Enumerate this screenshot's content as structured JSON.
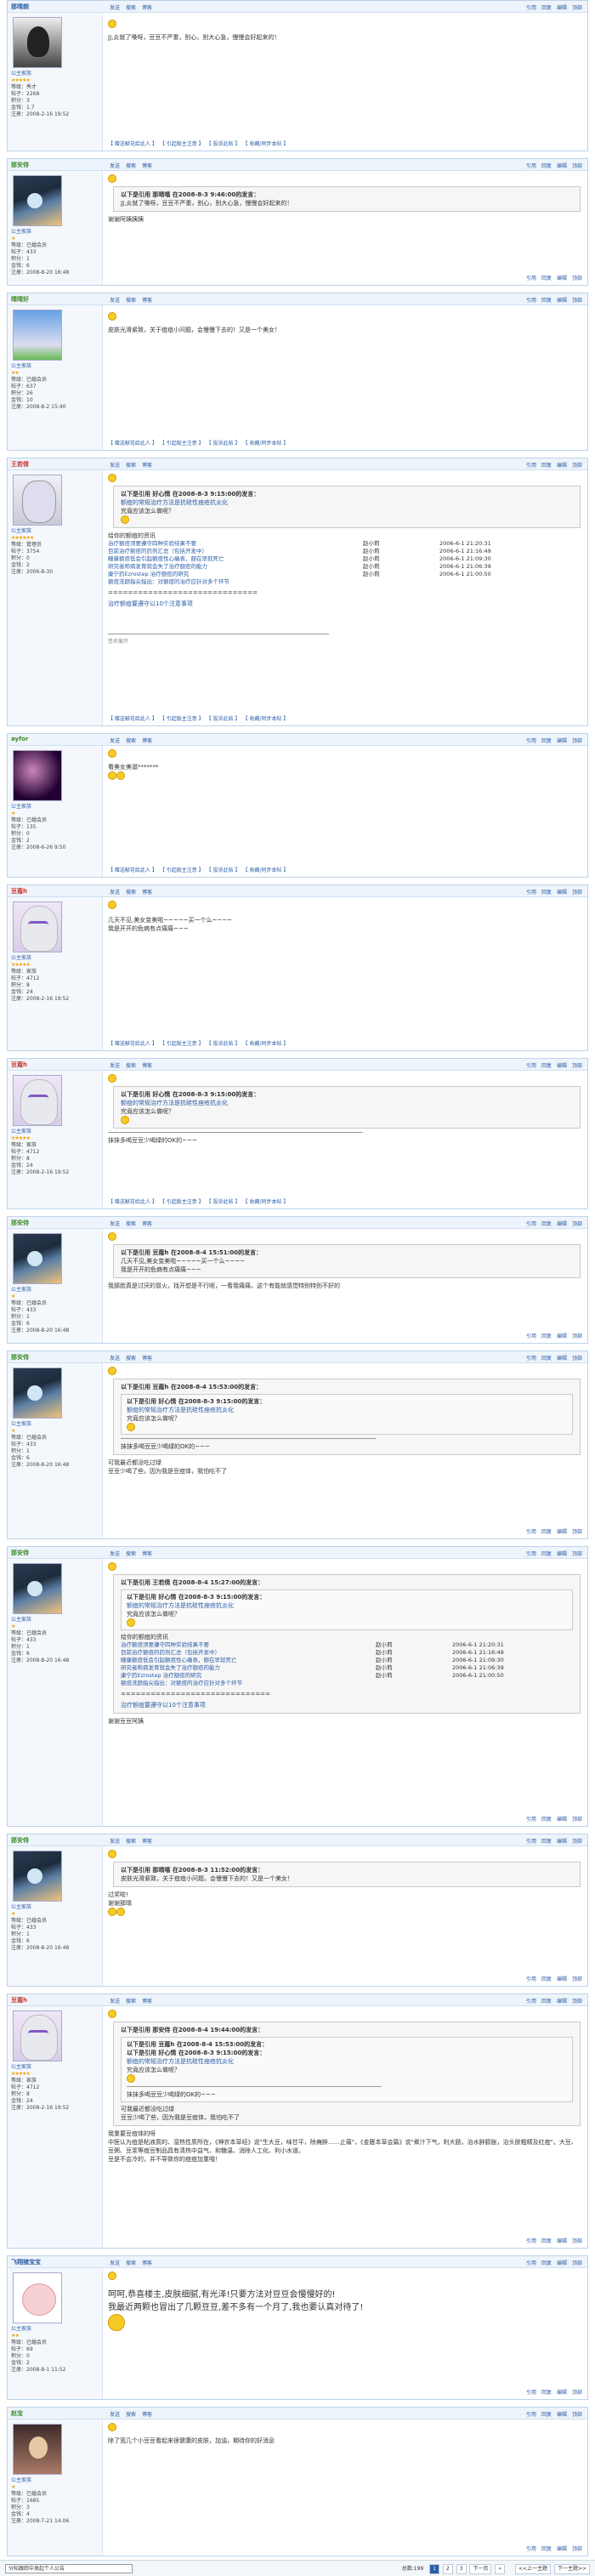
{
  "common": {
    "actions": [
      "发送",
      "搜索",
      "博客"
    ],
    "rightlinks": [
      "引用",
      "回复",
      "编辑",
      "顶部"
    ],
    "sig": [
      "【 赠送献花给此人 】",
      "【 引起版主注意 】",
      "【 投诉此帖 】",
      "【 收藏/同步本帖 】"
    ]
  },
  "posts": [
    {
      "user": "那晴朗",
      "group": "公主家族",
      "stars": "★★★★★",
      "info": [
        "等级：秀才",
        "帖子：2268",
        "积分：3",
        "金钱：1.7",
        "注册：2008-2-16 19:52"
      ],
      "body": "JJ,炎就了嗓呀，豆豆不严重，别心，别大心急，慢慢会好起来的！"
    },
    {
      "user": "那安侍",
      "group": "公主家族",
      "stars": "★",
      "info": [
        "等级：已婚会员",
        "帖子：433",
        "积分：1",
        "金钱：6",
        "注册：2008-8-20 16:48"
      ],
      "quote_head": "以下是引用 那晴嘻 在2008-8-3 9:46:00的发言：",
      "quote": "JJ,炎就了嗓呀，豆豆不严重，别心，别大心急，慢慢会好起来的！",
      "body": "谢谢阿姨姨姨"
    },
    {
      "user": "晴晴好",
      "group": "公主家族",
      "stars": "★★",
      "info": [
        "等级：已婚会员",
        "帖子：637",
        "积分：26",
        "金钱：10",
        "注册：2008-8-2 15:40"
      ],
      "body": "皮肤光滑紧致，关于痘痘小问题，会慢慢下去的！又是一个美女！"
    },
    {
      "user": "王若倩",
      "group": "公主家族",
      "stars": "★★★★★★",
      "info": [
        "等级：管理员",
        "帖子：3754",
        "积分：0",
        "金钱：2",
        "注册：2006-8-30"
      ],
      "quote_head": "以下是引用 好心情 在2008-8-3 9:15:00的发言：",
      "quote_lines": [
        "额痘的常规治疗方法是抗硅性痤疮抗炎化",
        "究竟应该怎么做呢？"
      ],
      "links_head": "给你的额痘的资讯",
      "links": [
        [
          "治疗额痘须要遵守四种实验结果不要",
          "赵小莉",
          "2006-6-1 21:20:31"
        ],
        [
          "目前治疗额痘的药剂汇总（包括开发中）",
          "赵小莉",
          "2006-6-1 21:16:49"
        ],
        [
          "瞳康额痘低会引起额痘性心痛表，额在早就死亡",
          "赵小莉",
          "2006-6-1 21:09:30"
        ],
        [
          "研究者称病发育就会失了治疗额痘的能力",
          "赵小莉",
          "2006-6-1 21:06:39"
        ],
        [
          "康宁药Ezrostep 治疗额痘的研究",
          "赵小莉",
          "2006-6-1 21:00:50"
        ],
        [
          "额痘洗颜指尖指出：对额痘的治疗应针对多个环节",
          "",
          ""
        ]
      ],
      "tail": "治疗额痘要遵守以10个注意事项",
      "footer": "签名展开"
    },
    {
      "user": "ayfor",
      "group": "公主家族",
      "stars": "★",
      "info": [
        "等级：已婚会员",
        "帖子：135",
        "积分：0",
        "金钱：2",
        "注册：2008-6-26 9:50"
      ],
      "body": "看美女美滋*******"
    },
    {
      "user": "豆蔻h",
      "group": "公主家族",
      "stars": "★★★★★",
      "info": [
        "等级：家族",
        "帖子：4712",
        "积分：8",
        "金钱：24",
        "注册：2008-2-16 19:52"
      ],
      "body": "几天不见,美女变美啦~~~~~买一个么~~~~",
      "body2": "我是开开的危病有点痛痛~~~"
    },
    {
      "user": "豆蔻h",
      "group": "公主家族",
      "stars": "★★★★★",
      "info": [
        "等级：家族",
        "帖子：4712",
        "积分：8",
        "金钱：24",
        "注册：2008-2-16 19:52"
      ],
      "quote_head": "以下是引用 好心情 在2008-8-3 9:15:00的发言：",
      "quote_lines": [
        "额痘的常规治疗方法是抗硅性痤疮抗炎化",
        "究竟应该怎么做呢？"
      ],
      "body": "抹抹多喝豆豆少喝绿的OK的~~~"
    },
    {
      "user": "那安侍",
      "group": "公主家族",
      "stars": "★",
      "info": [
        "等级：已婚会员",
        "帖子：433",
        "积分：1",
        "金钱：6",
        "注册：2008-8-20 16:48"
      ],
      "quote_head": "以下是引用 豆蔻h 在2008-8-4 15:51:00的发言：",
      "quote_lines": [
        "几天不见,美女变美啦~~~~~买一个么~~~~",
        "我是开开的危病有点痛痛~~~"
      ],
      "body": "我那脸真是讨厌的冒火，找开想是不行呢，一看我痛痛，这个有能就感觉特别特别不好的"
    },
    {
      "user": "那安侍",
      "group": "公主家族",
      "stars": "★",
      "info": [
        "等级：已婚会员",
        "帖子：433",
        "积分：1",
        "金钱：6",
        "注册：2008-8-20 16:48"
      ],
      "quote_head": "以下是引用 豆蔻h 在2008-8-4 15:53:00的发言：",
      "quote_inner": "以下是引用 好心情 在2008-8-3 9:15:00的发言：",
      "quote_lines": [
        "额痘的常规治疗方法是抗硅性痤疮抗炎化",
        "究竟应该怎么做呢？"
      ],
      "quote_after": "抹抹多喝豆豆少喝绿的OK的~~~",
      "body_lines": [
        "可我最近都没吃过绿",
        "豆豆少喝了些，因为我是豆痘体，我怕吃不了"
      ]
    },
    {
      "user": "那安侍",
      "group": "公主家族",
      "stars": "★",
      "info": [
        "等级：已婚会员",
        "帖子：433",
        "积分：1",
        "金钱：6",
        "注册：2008-8-20 16:48"
      ],
      "quote_head": "以下是引用 王若倩 在2008-8-4 15:27:00的发言：",
      "quote_inner": "以下是引用 好心情 在2008-8-3 9:15:00的发言：",
      "quote_lines": [
        "额痘的常规治疗方法是抗硅性痤疮抗炎化",
        "究竟应该怎么做呢？"
      ],
      "links_head": "给你的额痘的资讯",
      "links": [
        [
          "治疗额痘须要遵守四种实验结果不要",
          "赵小莉",
          "2006-6-1 21:20:31"
        ],
        [
          "目前治疗额痘的药剂汇总（包括开发中）",
          "赵小莉",
          "2006-6-1 21:16:49"
        ],
        [
          "瞳康额痘低会引起额痘性心痛表，额在早就死亡",
          "赵小莉",
          "2006-6-1 21:09:30"
        ],
        [
          "研究者称病发育就会失了治疗额痘的能力",
          "赵小莉",
          "2006-6-1 21:06:39"
        ],
        [
          "康宁药Ezrostep 治疗额痘的研究",
          "赵小莉",
          "2006-6-1 21:00:50"
        ],
        [
          "额痘洗颜指尖指出：对额痘的治疗应针对多个环节",
          "",
          ""
        ]
      ],
      "tail": "治疗额痘要遵守以10个注意事项",
      "body": "谢谢豆豆阿姨"
    },
    {
      "user": "那安侍",
      "group": "公主家族",
      "stars": "★",
      "info": [
        "等级：已婚会员",
        "帖子：433",
        "积分：1",
        "金钱：6",
        "注册：2008-8-20 16:48"
      ],
      "quote_head": "以下是引用 那晴嘻 在2008-8-3 11:52:00的发言：",
      "quote": "皮肤光滑紧致，关于痘痘小问题，会慢慢下去的！又是一个美女！",
      "body_lines": [
        "过奖啦!",
        "谢谢那晴"
      ]
    },
    {
      "user": "豆蔻h",
      "group": "公主家族",
      "stars": "★★★★★",
      "info": [
        "等级：家族",
        "帖子：4712",
        "积分：8",
        "金钱：24",
        "注册：2008-2-16 19:52"
      ],
      "quote_head": "以下是引用 那安侍 在2008-8-4 19:44:00的发言：",
      "quote_inner": "以下是引用 豆蔻h 在2008-8-4 15:53:00的发言：",
      "quote_inner2": "以下是引用 好心情 在2008-8-3 9:15:00的发言：",
      "quote_lines": [
        "额痘的常规治疗方法是抗硅性痤疮抗炎化",
        "究竟应该怎么做呢？"
      ],
      "quote_after": "抹抹多喝豆豆少喝绿的OK的~~~",
      "quote_after2": [
        "可我最近都没吃过绿",
        "豆豆少喝了些，因为我是豆痘体，我怕吃不了"
      ],
      "body_lines": [
        "我重要豆痘体的呀",
        "中医认为痘是粘液质的、湿热性质所在，《神农本草经》说\"生大豆，味甘平，除痈肿……止痛\"，《金匮本草会篇》说\"煮汁下气，利大肠，治水肿膨胀，治头肤粗精及红痘\"。大豆、豆粥、豆浆等痘豆制品具有清热中益气、和糖温、消除人工化、利小水道。",
        "豆是不会冷的，并不导致你的痘痘加重哦！"
      ]
    },
    {
      "user": "飞翔猪宝宝",
      "group": "公主家族",
      "stars": "★★",
      "info": [
        "等级：已婚会员",
        "帖子：69",
        "积分：0",
        "金钱：2",
        "注册：2008-8-1 11:52"
      ],
      "big": [
        "呵呵,恭喜楼主,皮肤细腻,有光泽!只要方法对豆豆会慢慢好的!",
        "我最近两颗也冒出了几颗豆豆,差不多有一个月了,我也要认真对待了!"
      ]
    },
    {
      "user": "赵宝",
      "group": "公主家族",
      "stars": "★",
      "info": [
        "等级：已婚会员",
        "帖子：1685",
        "积分：3",
        "金钱：4",
        "注册：2008-7-21 14:06"
      ],
      "body": "除了宽几个小豆豆看起来很健康的皮肤，加油，期待你的好消息"
    }
  ],
  "bottom": {
    "select": "分帖跟踪中发起个人公告",
    "pager": [
      "总数:199",
      "1",
      "2",
      "3",
      "下一页",
      "»"
    ],
    "right": [
      "<<上一主题",
      "下一主题>>"
    ]
  }
}
